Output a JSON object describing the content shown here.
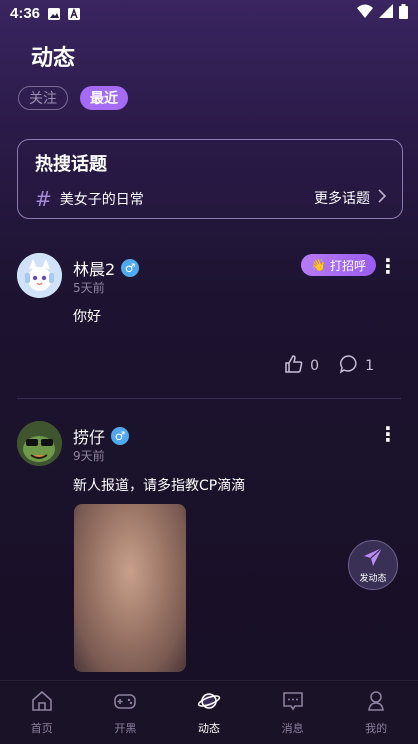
{
  "status_bar": {
    "time": "4:36"
  },
  "page": {
    "title": "动态"
  },
  "tabs": [
    {
      "label": "关注",
      "active": false
    },
    {
      "label": "最近",
      "active": true
    }
  ],
  "hot_topics": {
    "title": "热搜话题",
    "topic": "美女子的日常",
    "more_label": "更多话题"
  },
  "posts": [
    {
      "username": "林晨2",
      "gender": "♂",
      "time_ago": "5天前",
      "content": "你好",
      "greet_label": "打招呼",
      "likes": "0",
      "comments": "1"
    },
    {
      "username": "捞仔",
      "gender": "♂",
      "time_ago": "9天前",
      "content": "新人报道，请多指教CP滴滴"
    }
  ],
  "fab": {
    "label": "发动态"
  },
  "nav": [
    {
      "label": "首页",
      "icon": "home-icon",
      "active": false
    },
    {
      "label": "开黑",
      "icon": "gamepad-icon",
      "active": false
    },
    {
      "label": "动态",
      "icon": "planet-icon",
      "active": true
    },
    {
      "label": "消息",
      "icon": "message-icon",
      "active": false
    },
    {
      "label": "我的",
      "icon": "profile-icon",
      "active": false
    }
  ],
  "colors": {
    "accent": "#a66bf5",
    "background": "#1d1330",
    "gender_badge": "#4fa8f0"
  }
}
